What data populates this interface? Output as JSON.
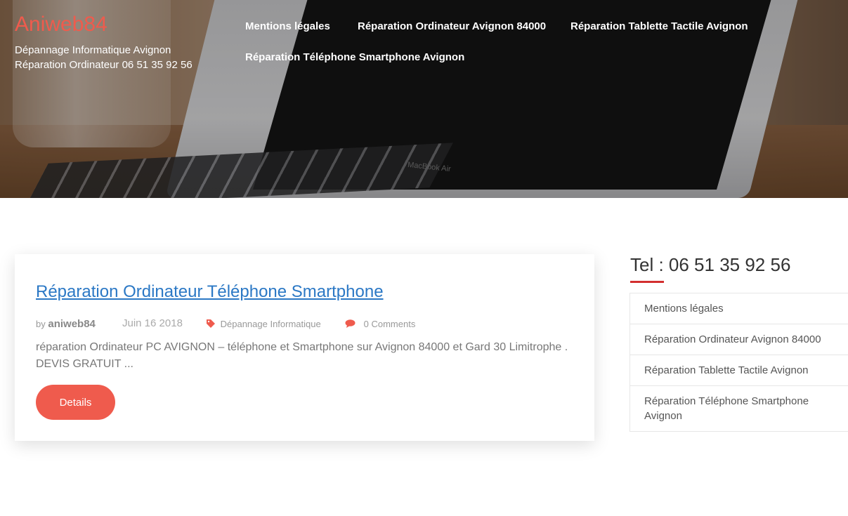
{
  "site": {
    "title": "Aniweb84",
    "tagline": "Dépannage Informatique Avignon Réparation Ordinateur 06 51 35 92 56",
    "hero_brand_text": "MacBook Air"
  },
  "nav": {
    "items": [
      {
        "label": "Mentions légales"
      },
      {
        "label": "Réparation Ordinateur Avignon 84000"
      },
      {
        "label": "Réparation Tablette Tactile Avignon"
      },
      {
        "label": "Réparation Téléphone Smartphone Avignon"
      }
    ]
  },
  "post": {
    "title": "Réparation Ordinateur Téléphone Smartphone",
    "by_label": "by",
    "author": "aniweb84",
    "date": "Juin 16 2018",
    "category": "Dépannage Informatique",
    "comments": "0 Comments",
    "excerpt": "réparation Ordinateur PC AVIGNON –  téléphone et Smartphone sur Avignon 84000 et Gard 30 Limitrophe . DEVIS GRATUIT ...",
    "details_label": "Details",
    "icons": {
      "category": "tag-icon",
      "comments": "comment-icon"
    }
  },
  "sidebar": {
    "widget_title": "Tel : 06 51 35 92 56",
    "menu": [
      {
        "label": "Mentions légales"
      },
      {
        "label": "Réparation Ordinateur Avignon 84000"
      },
      {
        "label": "Réparation Tablette Tactile Avignon"
      },
      {
        "label": "Réparation Téléphone Smartphone Avignon"
      }
    ]
  },
  "colors": {
    "accent": "#ef5b4d",
    "link": "#2b78c5",
    "underline": "#d32f2f"
  }
}
